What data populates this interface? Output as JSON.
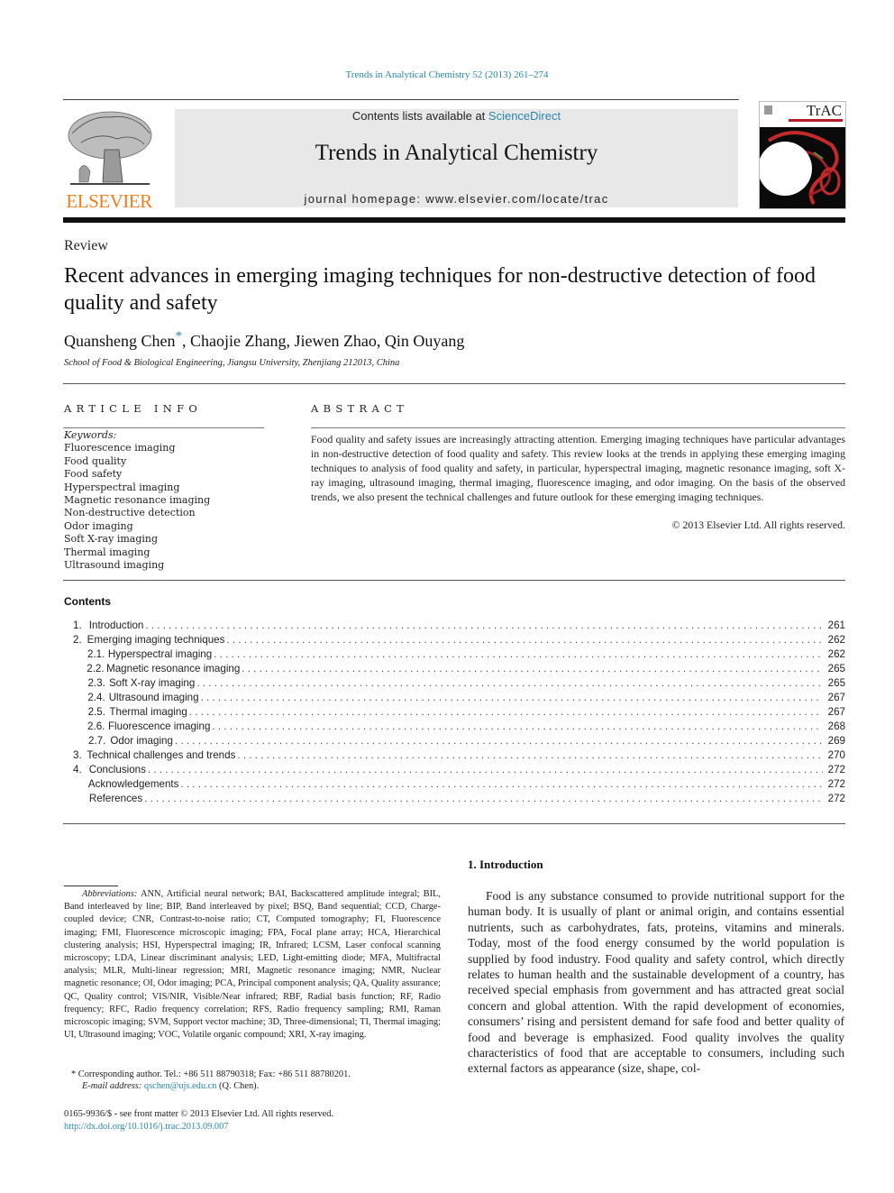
{
  "header": {
    "citation": "Trends in Analytical Chemistry 52 (2013) 261–274",
    "publisher_logo_text": "ELSEVIER",
    "contents_prefix": "Contents lists available at ",
    "contents_link": "ScienceDirect",
    "journal_title": "Trends in Analytical Chemistry",
    "homepage": "journal homepage: www.elsevier.com/locate/trac",
    "cover_title": "TrAC"
  },
  "colors": {
    "link": "#2a87b0",
    "elsevier_orange": "#f07e1e",
    "masthead_bg": "#e8e8e8"
  },
  "article": {
    "type": "Review",
    "title": "Recent advances in emerging imaging techniques for non-destructive detection of food quality and safety",
    "authors": "Quansheng Chen",
    "author_star": "*",
    "authors_rest": ", Chaojie Zhang, Jiewen Zhao, Qin Ouyang",
    "affiliation": "School of Food & Biological Engineering, Jiangsu University, Zhenjiang 212013, China"
  },
  "article_info": {
    "heading": "ARTICLE INFO",
    "keywords_label": "Keywords:",
    "keywords": [
      "Fluorescence imaging",
      "Food quality",
      "Food safety",
      "Hyperspectral imaging",
      "Magnetic resonance imaging",
      "Non-destructive detection",
      "Odor imaging",
      "Soft X-ray imaging",
      "Thermal imaging",
      "Ultrasound imaging"
    ]
  },
  "abstract": {
    "heading": "ABSTRACT",
    "text": "Food quality and safety issues are increasingly attracting attention. Emerging imaging techniques have particular advantages in non-destructive detection of food quality and safety. This review looks at the trends in applying these emerging imaging techniques to analysis of food quality and safety, in particular, hyperspectral imaging, magnetic resonance imaging, soft X-ray imaging, ultrasound imaging, thermal imaging, fluorescence imaging, and odor imaging. On the basis of the observed trends, we also present the technical challenges and future outlook for these emerging imaging techniques.",
    "copyright": "© 2013 Elsevier Ltd. All rights reserved."
  },
  "contents": {
    "heading": "Contents",
    "items": [
      {
        "num": "1.",
        "sub": "",
        "label": "Introduction",
        "page": "261"
      },
      {
        "num": "2.",
        "sub": "",
        "label": "Emerging imaging techniques",
        "page": "262"
      },
      {
        "num": "",
        "sub": "2.1.",
        "label": "Hyperspectral imaging",
        "page": "262"
      },
      {
        "num": "",
        "sub": "2.2.",
        "label": "Magnetic resonance imaging",
        "page": "265"
      },
      {
        "num": "",
        "sub": "2.3.",
        "label": "Soft X-ray imaging",
        "page": "265"
      },
      {
        "num": "",
        "sub": "2.4.",
        "label": "Ultrasound imaging",
        "page": "267"
      },
      {
        "num": "",
        "sub": "2.5.",
        "label": "Thermal imaging",
        "page": "267"
      },
      {
        "num": "",
        "sub": "2.6.",
        "label": "Fluorescence imaging",
        "page": "268"
      },
      {
        "num": "",
        "sub": "2.7.",
        "label": "Odor imaging",
        "page": "269"
      },
      {
        "num": "3.",
        "sub": "",
        "label": "Technical challenges and trends",
        "page": "270"
      },
      {
        "num": "4.",
        "sub": "",
        "label": "Conclusions",
        "page": "272"
      },
      {
        "num": "",
        "sub": "",
        "label": "Acknowledgements",
        "page": "272"
      },
      {
        "num": "",
        "sub": "",
        "label": "References",
        "page": "272"
      }
    ]
  },
  "footnotes": {
    "abbreviations_label": "Abbreviations:",
    "abbreviations": "ANN, Artificial neural network; BAI, Backscattered amplitude integral; BIL, Band interleaved by line; BIP, Band interleaved by pixel; BSQ, Band sequential; CCD, Charge-coupled device; CNR, Contrast-to-noise ratio; CT, Computed tomography; FI, Fluorescence imaging; FMI, Fluorescence microscopic imaging; FPA, Focal plane array; HCA, Hierarchical clustering analysis; HSI, Hyperspectral imaging; IR, Infrared; LCSM, Laser confocal scanning microscopy; LDA, Linear discriminant analysis; LED, Light-emitting diode; MFA, Multifractal analysis; MLR, Multi-linear regression; MRI, Magnetic resonance imaging; NMR, Nuclear magnetic resonance; OI, Odor imaging; PCA, Principal component analysis; QA, Quality assurance; QC, Quality control; VIS/NIR, Visible/Near infrared; RBF, Radial basis function; RF, Radio frequency; RFC, Radio frequency correlation; RFS, Radio frequency sampling; RMI, Raman microscopic imaging; SVM, Support vector machine; 3D, Three-dimensional; TI, Thermal imaging; UI, Ultrasound imaging; VOC, Volatile organic compound; XRI, X-ray imaging.",
    "corresponding": "* Corresponding author. Tel.: +86 511 88790318; Fax: +86 511 88780201.",
    "email_label": "E-mail address:",
    "email": "qschen@ujs.edu.cn",
    "email_suffix": " (Q. Chen).",
    "issn_line": "0165-9936/$ - see front matter © 2013 Elsevier Ltd. All rights reserved.",
    "doi": "http://dx.doi.org/10.1016/j.trac.2013.09.007"
  },
  "introduction": {
    "heading": "1. Introduction",
    "text": "Food is any substance consumed to provide nutritional support for the human body. It is usually of plant or animal origin, and contains essential nutrients, such as carbohydrates, fats, proteins, vitamins and minerals. Today, most of the food energy consumed by the world population is supplied by food industry. Food quality and safety control, which directly relates to human health and the sustainable development of a country, has received special emphasis from government and has attracted great social concern and global attention. With the rapid development of economies, consumers’ rising and persistent demand for safe food and better quality of food and beverage is emphasized. Food quality involves the quality characteristics of food that are acceptable to consumers, including such external factors as appearance (size, shape, col-"
  }
}
